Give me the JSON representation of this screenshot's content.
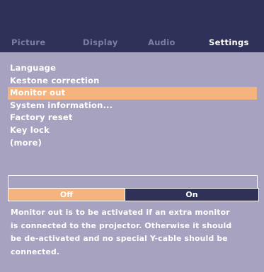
{
  "tabs": [
    {
      "label": "Picture"
    },
    {
      "label": "Display"
    },
    {
      "label": "Audio"
    },
    {
      "label": "Settings",
      "active": true
    }
  ],
  "menu": {
    "items": [
      {
        "label": "Language"
      },
      {
        "label": "Kestone correction"
      },
      {
        "label": "Monitor out",
        "selected": true
      },
      {
        "label": "System information..."
      },
      {
        "label": "Factory reset"
      },
      {
        "label": "Key lock"
      },
      {
        "label": "(more)"
      }
    ]
  },
  "toggle": {
    "options": [
      {
        "label": "Off",
        "selected": true
      },
      {
        "label": "On",
        "selected": false
      }
    ]
  },
  "help_lines": [
    "Monitor out is to be activated if an extra monitor",
    "is connected to the projector. Otherwise it should",
    "be de-activated and no special Y-cable should be",
    "connected."
  ],
  "colors": {
    "panel": "#a6a2c0",
    "header": "#2f3158",
    "highlight": "#f4b37f",
    "text": "#ffffff",
    "inactive_tab": "#7c7ea6"
  }
}
